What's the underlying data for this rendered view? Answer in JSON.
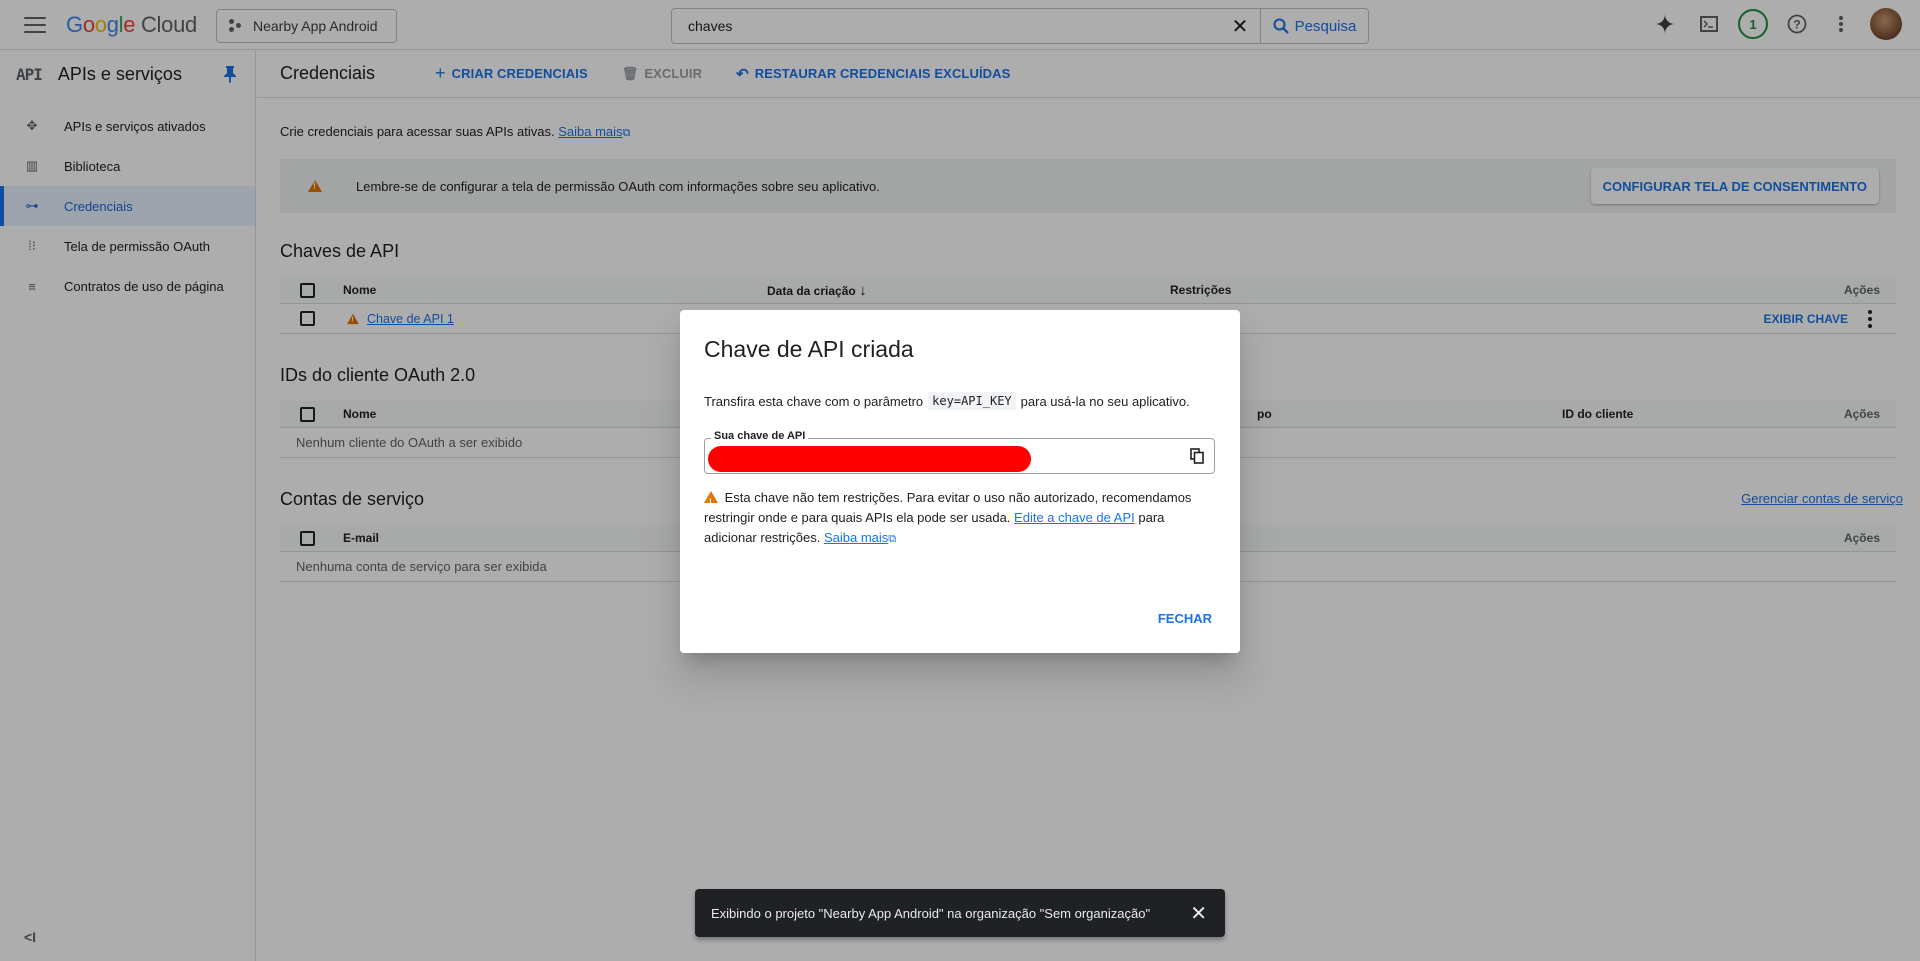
{
  "header": {
    "logo_google": "Google",
    "logo_cloud": "Cloud",
    "project": "Nearby App Android",
    "search_value": "chaves",
    "search_button": "Pesquisa",
    "notification_count": "1"
  },
  "sidebar": {
    "badge": "API",
    "title": "APIs e serviços",
    "items": [
      {
        "label": "APIs e serviços ativados",
        "icon": "api-hub-icon"
      },
      {
        "label": "Biblioteca",
        "icon": "library-icon"
      },
      {
        "label": "Credenciais",
        "icon": "key-icon",
        "active": true
      },
      {
        "label": "Tela de permissão OAuth",
        "icon": "consent-icon"
      },
      {
        "label": "Contratos de uso de página",
        "icon": "page-settings-icon"
      }
    ],
    "collapse": "<I"
  },
  "main": {
    "title": "Credenciais",
    "create": "CRIAR CREDENCIAIS",
    "delete": "EXCLUIR",
    "restore": "RESTAURAR CREDENCIAIS EXCLUÍDAS",
    "intro": "Crie credenciais para acessar suas APIs ativas.",
    "intro_link": "Saiba mais",
    "banner": "Lembre-se de configurar a tela de permissão OAuth com informações sobre seu aplicativo.",
    "banner_button": "CONFIGURAR TELA DE CONSENTIMENTO",
    "api_keys": {
      "title": "Chaves de API",
      "col_name": "Nome",
      "col_date": "Data da criação",
      "col_restrictions": "Restrições",
      "col_actions": "Ações",
      "row_name": "Chave de API 1",
      "row_action": "EXIBIR CHAVE"
    },
    "oauth": {
      "title": "IDs do cliente OAuth 2.0",
      "col_name": "Nome",
      "col_type_partial": "po",
      "col_client_id": "ID do cliente",
      "col_actions": "Ações",
      "empty": "Nenhum cliente do OAuth a ser exibido"
    },
    "service": {
      "title": "Contas de serviço",
      "manage": "Gerenciar contas de serviço",
      "col_email": "E-mail",
      "col_actions": "Ações",
      "empty": "Nenhuma conta de serviço para ser exibida"
    }
  },
  "dialog": {
    "title": "Chave de API criada",
    "text_before": "Transfira esta chave com o parâmetro",
    "code": "key=API_KEY",
    "text_after": "para usá-la no seu aplicativo.",
    "field_label": "Sua chave de API",
    "warn_text_1": "Esta chave não tem restrições. Para evitar o uso não autorizado, recomendamos restringir onde e para quais APIs ela pode ser usada.",
    "warn_link": "Edite a chave de API",
    "warn_text_2": "para adicionar restrições.",
    "warn_link_2": "Saiba mais",
    "close": "FECHAR"
  },
  "snackbar": {
    "text": "Exibindo o projeto \"Nearby App Android\" na organização \"Sem organização\""
  },
  "colors": {
    "accent": "#1a73e8",
    "warning": "#e37400",
    "redaction": "#ff0000"
  }
}
